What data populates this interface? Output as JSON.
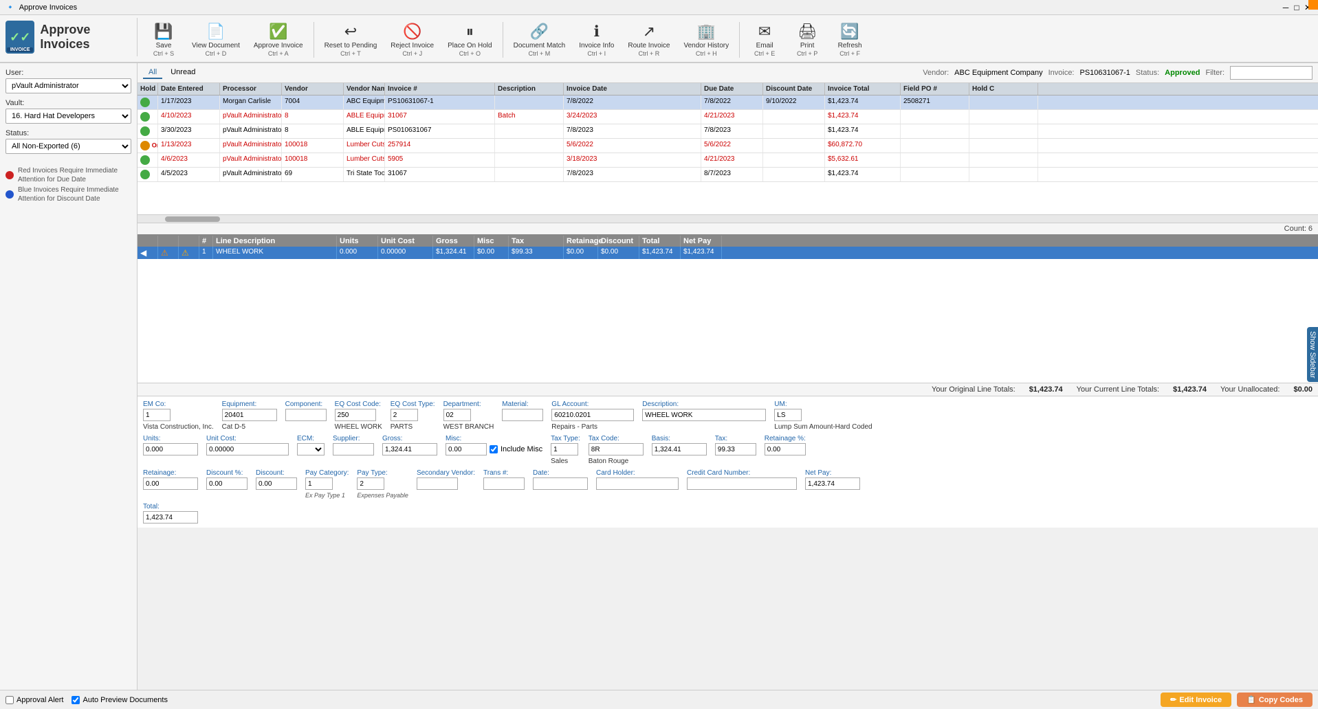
{
  "titleBar": {
    "title": "Approve Invoices",
    "minimizeIcon": "─",
    "restoreIcon": "□",
    "closeIcon": "✕"
  },
  "appLogo": {
    "title": "Approve Invoices",
    "subtext": "INVOICE"
  },
  "ribbon": {
    "buttons": [
      {
        "id": "save",
        "icon": "💾",
        "label": "Save",
        "shortcut": "Ctrl + S"
      },
      {
        "id": "view-document",
        "icon": "📄",
        "label": "View Document",
        "shortcut": "Ctrl + D"
      },
      {
        "id": "approve-invoice",
        "icon": "✅",
        "label": "Approve Invoice",
        "shortcut": "Ctrl + A"
      },
      {
        "id": "reset-to-pending",
        "icon": "↩",
        "label": "Reset to Pending",
        "shortcut": "Ctrl + T"
      },
      {
        "id": "reject-invoice",
        "icon": "🚫",
        "label": "Reject Invoice",
        "shortcut": "Ctrl + J"
      },
      {
        "id": "place-on-hold",
        "icon": "⏸",
        "label": "Place On Hold",
        "shortcut": "Ctrl + O"
      },
      {
        "id": "document-match",
        "icon": "🔗",
        "label": "Document Match",
        "shortcut": "Ctrl + M"
      },
      {
        "id": "invoice-info",
        "icon": "ℹ",
        "label": "Invoice Info",
        "shortcut": "Ctrl + I"
      },
      {
        "id": "route-invoice",
        "icon": "↗",
        "label": "Route Invoice",
        "shortcut": "Ctrl + R"
      },
      {
        "id": "vendor-history",
        "icon": "🏢",
        "label": "Vendor History",
        "shortcut": "Ctrl + H"
      },
      {
        "id": "email",
        "icon": "✉",
        "label": "Email",
        "shortcut": "Ctrl + E"
      },
      {
        "id": "print",
        "icon": "🖨",
        "label": "Print",
        "shortcut": "Ctrl + P"
      },
      {
        "id": "refresh",
        "icon": "🔄",
        "label": "Refresh",
        "shortcut": "Ctrl + F"
      }
    ]
  },
  "leftPanel": {
    "userLabel": "User:",
    "userValue": "pVault Administrator",
    "vaultLabel": "Vault:",
    "vaultValue": "16. Hard Hat Developers",
    "statusLabel": "Status:",
    "statusValue": "All Non-Exported (6)",
    "legends": [
      {
        "color": "#cc2222",
        "text": "Red Invoices Require Immediate Attention for Due Date"
      },
      {
        "color": "#2255cc",
        "text": "Blue Invoices Require Immediate Attention for Discount Date"
      }
    ]
  },
  "filterBar": {
    "tabs": [
      "All",
      "Unread"
    ],
    "activeTab": "All",
    "vendorLabel": "Vendor:",
    "vendorValue": "ABC Equipment Company",
    "invoiceLabel": "Invoice:",
    "invoiceValue": "PS10631067-1",
    "statusLabel": "Status:",
    "statusValue": "Approved",
    "filterLabel": "Filter:",
    "filterValue": ""
  },
  "gridColumns": [
    "Hold Status",
    "Date Entered",
    "Processor",
    "Vendor",
    "Vendor Name",
    "Invoice #",
    "Description",
    "Invoice Date",
    "Due Date",
    "Discount Date",
    "Invoice Total",
    "Field PO #",
    "Hold C"
  ],
  "gridRows": [
    {
      "holdStatus": "green",
      "dateEntered": "1/17/2023",
      "processor": "Morgan Carlisle",
      "vendor": "7004",
      "vendorName": "ABC Equipment Company",
      "invoiceNum": "PS10631067-1",
      "description": "",
      "invoiceDate": "7/8/2022",
      "dueDate": "7/8/2022",
      "discountDate": "9/10/2022",
      "invoiceTotal": "$1,423.74",
      "fieldPO": "2508271",
      "holdC": "",
      "isSelected": true,
      "rowStyle": "normal"
    },
    {
      "holdStatus": "green",
      "dateEntered": "4/10/2023",
      "processor": "pVault Administrator",
      "vendor": "8",
      "vendorName": "ABLE Equipment Rental Inc",
      "invoiceNum": "31067",
      "description": "Batch",
      "invoiceDate": "3/24/2023",
      "dueDate": "4/21/2023",
      "discountDate": "",
      "invoiceTotal": "$1,423.74",
      "fieldPO": "",
      "holdC": "",
      "isSelected": false,
      "rowStyle": "red"
    },
    {
      "holdStatus": "green",
      "dateEntered": "3/30/2023",
      "processor": "pVault Administrator",
      "vendor": "8",
      "vendorName": "ABLE Equipment Rental Inc",
      "invoiceNum": "PS010631067",
      "description": "",
      "invoiceDate": "7/8/2023",
      "dueDate": "7/8/2023",
      "discountDate": "",
      "invoiceTotal": "$1,423.74",
      "fieldPO": "",
      "holdC": "",
      "isSelected": false,
      "rowStyle": "normal"
    },
    {
      "holdStatus": "orange",
      "holdLabel": "On Hold",
      "dateEntered": "1/13/2023",
      "processor": "pVault Administrator",
      "vendor": "100018",
      "vendorName": "Lumber Cuts",
      "invoiceNum": "257914",
      "description": "",
      "invoiceDate": "5/6/2022",
      "dueDate": "5/6/2022",
      "discountDate": "",
      "invoiceTotal": "$60,872.70",
      "fieldPO": "",
      "holdC": "",
      "isSelected": false,
      "rowStyle": "red"
    },
    {
      "holdStatus": "green",
      "dateEntered": "4/6/2023",
      "processor": "pVault Administrator",
      "vendor": "100018",
      "vendorName": "Lumber Cuts",
      "invoiceNum": "5905",
      "description": "",
      "invoiceDate": "3/18/2023",
      "dueDate": "4/21/2023",
      "discountDate": "",
      "invoiceTotal": "$5,632.61",
      "fieldPO": "",
      "holdC": "",
      "isSelected": false,
      "rowStyle": "red"
    },
    {
      "holdStatus": "green",
      "dateEntered": "4/5/2023",
      "processor": "pVault Administrator",
      "vendor": "69",
      "vendorName": "Tri State Tool & Hoist, Inc.",
      "invoiceNum": "31067",
      "description": "",
      "invoiceDate": "7/8/2023",
      "dueDate": "8/7/2023",
      "discountDate": "",
      "invoiceTotal": "$1,423.74",
      "fieldPO": "",
      "holdC": "",
      "isSelected": false,
      "rowStyle": "normal"
    }
  ],
  "countBar": {
    "label": "Count:",
    "value": "6"
  },
  "detailHeader": {
    "columns": [
      "",
      "",
      "",
      "#",
      "Line Description",
      "Units",
      "Unit Cost",
      "Gross",
      "Misc",
      "Tax",
      "Retainage",
      "Discount",
      "Total",
      "Net Pay"
    ]
  },
  "detailRow": {
    "col1": "",
    "col2": "",
    "col3": "",
    "lineNum": "1",
    "description": "WHEEL WORK",
    "units": "0.000",
    "unitCost": "0.00000",
    "gross": "$1,324.41",
    "misc": "$0.00",
    "tax": "$99.33",
    "retainage": "$0.00",
    "discount": "$0.00",
    "total": "$1,423.74",
    "netPay": "$1,423.74"
  },
  "totalsBar": {
    "originalLabel": "Your Original Line Totals:",
    "originalValue": "$1,423.74",
    "currentLabel": "Your Current Line Totals:",
    "currentValue": "$1,423.74",
    "unallocatedLabel": "Your Unallocated:",
    "unallocatedValue": "$0.00"
  },
  "bottomForm": {
    "row1": {
      "emCoLabel": "EM Co:",
      "emCoValue": "1",
      "emCoSub": "Vista Construction, Inc.",
      "equipmentLabel": "Equipment:",
      "equipmentValue": "20401",
      "equipmentSub": "Cat D-5",
      "componentLabel": "Component:",
      "componentValue": "",
      "eqCostCodeLabel": "EQ Cost Code:",
      "eqCostCodeValue": "250",
      "eqCostCodeSub": "WHEEL WORK",
      "eqCostTypeLabel": "EQ Cost Type:",
      "eqCostTypeValue": "2",
      "eqCostTypeSub": "PARTS",
      "departmentLabel": "Department:",
      "departmentValue": "02",
      "departmentSub": "WEST BRANCH",
      "materialLabel": "Material:",
      "materialValue": "",
      "glAccountLabel": "GL Account:",
      "glAccountValue": "60210.0201",
      "glAccountSub": "Repairs - Parts",
      "descriptionLabel": "Description:",
      "descriptionValue": "WHEEL WORK",
      "umLabel": "UM:",
      "umValue": "LS",
      "umSub": "Lump Sum Amount-Hard Coded"
    },
    "row2": {
      "unitsLabel": "Units:",
      "unitsValue": "0.000",
      "unitCostLabel": "Unit Cost:",
      "unitCostValue": "0.00000",
      "ecmLabel": "ECM:",
      "ecmValue": "",
      "supplierLabel": "Supplier:",
      "supplierValue": "",
      "grossLabel": "Gross:",
      "grossValue": "1,324.41",
      "miscLabel": "Misc:",
      "miscValue": "0.00",
      "includeMiscLabel": "Include Misc",
      "taxTypeLabel": "Tax Type:",
      "taxTypeValue": "1",
      "taxTypeSub": "Sales",
      "taxCodeLabel": "Tax Code:",
      "taxCodeValue": "8R",
      "taxCodeSub": "Baton Rouge",
      "basisLabel": "Basis:",
      "basisValue": "1,324.41",
      "taxLabel": "Tax:",
      "taxValue": "99.33",
      "retainagePctLabel": "Retainage %:",
      "retainagePctValue": "0.00"
    },
    "row3": {
      "retainageLabel": "Retainage:",
      "retainageValue": "0.00",
      "discountPctLabel": "Discount %:",
      "discountPctValue": "0.00",
      "discountLabel": "Discount:",
      "discountValue": "0.00",
      "payCategoryLabel": "Pay Category:",
      "payCategoryValue": "1",
      "payCategorySub": "Ex Pay Type 1",
      "payTypeLabel": "Pay Type:",
      "payTypeValue": "2",
      "payTypeSub": "Expenses Payable",
      "secondaryVendorLabel": "Secondary Vendor:",
      "secondaryVendorValue": "",
      "transNumLabel": "Trans #:",
      "transNumValue": "",
      "dateLabel": "Date:",
      "dateValue": "",
      "cardHolderLabel": "Card Holder:",
      "cardHolderValue": "",
      "creditCardLabel": "Credit Card Number:",
      "creditCardValue": "",
      "netPayLabel": "Net Pay:",
      "netPayValue": "1,423.74"
    },
    "row4": {
      "totalLabel": "Total:",
      "totalValue": "1,423.74"
    }
  },
  "statusBar": {
    "alertLabel": "Approval Alert",
    "autoPreviewLabel": "Auto Preview Documents",
    "editInvoiceLabel": "Edit Invoice",
    "copyCodesLabel": "Copy Codes"
  },
  "sideHandle": {
    "label": "Show Sidebar"
  }
}
